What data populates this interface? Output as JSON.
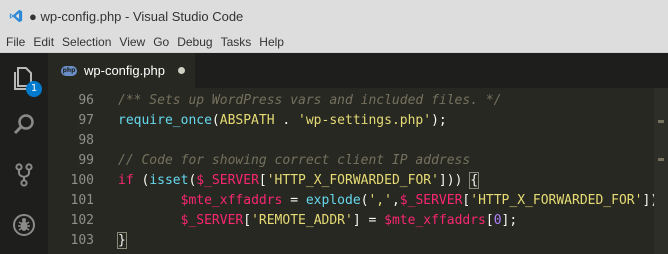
{
  "window": {
    "title": "● wp-config.php - Visual Studio Code"
  },
  "menu": [
    "File",
    "Edit",
    "Selection",
    "View",
    "Go",
    "Debug",
    "Tasks",
    "Help"
  ],
  "activity": {
    "explorer_badge": "1"
  },
  "tab": {
    "icon_text": "php",
    "label": "wp-config.php"
  },
  "editor": {
    "ghost_line": "                                         ",
    "lines": [
      {
        "number": "96",
        "tokens": [
          {
            "t": "/** Sets up WordPress vars and included files. */",
            "c": "cmt"
          }
        ]
      },
      {
        "number": "97",
        "tokens": [
          {
            "t": "require_once",
            "c": "fn"
          },
          {
            "t": "(",
            "c": "plain"
          },
          {
            "t": "ABSPATH",
            "c": "str"
          },
          {
            "t": " . ",
            "c": "plain"
          },
          {
            "t": "'wp-settings.php'",
            "c": "str"
          },
          {
            "t": ");",
            "c": "plain"
          }
        ]
      },
      {
        "number": "98",
        "tokens": []
      },
      {
        "number": "99",
        "tokens": [
          {
            "t": "// Code for showing correct client IP address",
            "c": "cmt"
          }
        ]
      },
      {
        "number": "100",
        "tokens": [
          {
            "t": "if",
            "c": "kw"
          },
          {
            "t": " (",
            "c": "plain"
          },
          {
            "t": "isset",
            "c": "fn"
          },
          {
            "t": "(",
            "c": "plain"
          },
          {
            "t": "$_SERVER",
            "c": "var"
          },
          {
            "t": "[",
            "c": "plain"
          },
          {
            "t": "'HTTP_X_FORWARDED_FOR'",
            "c": "str"
          },
          {
            "t": "])) ",
            "c": "plain"
          },
          {
            "t": "{",
            "c": "bracket"
          }
        ]
      },
      {
        "number": "101",
        "tokens": [
          {
            "t": "        ",
            "c": "plain"
          },
          {
            "t": "$mte_xffaddrs",
            "c": "var"
          },
          {
            "t": " = ",
            "c": "plain"
          },
          {
            "t": "explode",
            "c": "fn"
          },
          {
            "t": "(",
            "c": "plain"
          },
          {
            "t": "','",
            "c": "str"
          },
          {
            "t": ",",
            "c": "plain"
          },
          {
            "t": "$_SERVER",
            "c": "var"
          },
          {
            "t": "[",
            "c": "plain"
          },
          {
            "t": "'HTTP_X_FORWARDED_FOR'",
            "c": "str"
          },
          {
            "t": "]);",
            "c": "plain"
          }
        ]
      },
      {
        "number": "102",
        "tokens": [
          {
            "t": "        ",
            "c": "plain"
          },
          {
            "t": "$_SERVER",
            "c": "var"
          },
          {
            "t": "[",
            "c": "plain"
          },
          {
            "t": "'REMOTE_ADDR'",
            "c": "str"
          },
          {
            "t": "] = ",
            "c": "plain"
          },
          {
            "t": "$mte_xffaddrs",
            "c": "var"
          },
          {
            "t": "[",
            "c": "plain"
          },
          {
            "t": "0",
            "c": "num"
          },
          {
            "t": "];",
            "c": "plain"
          }
        ]
      },
      {
        "number": "103",
        "tokens": [
          {
            "t": "}",
            "c": "bracket"
          }
        ]
      }
    ]
  }
}
